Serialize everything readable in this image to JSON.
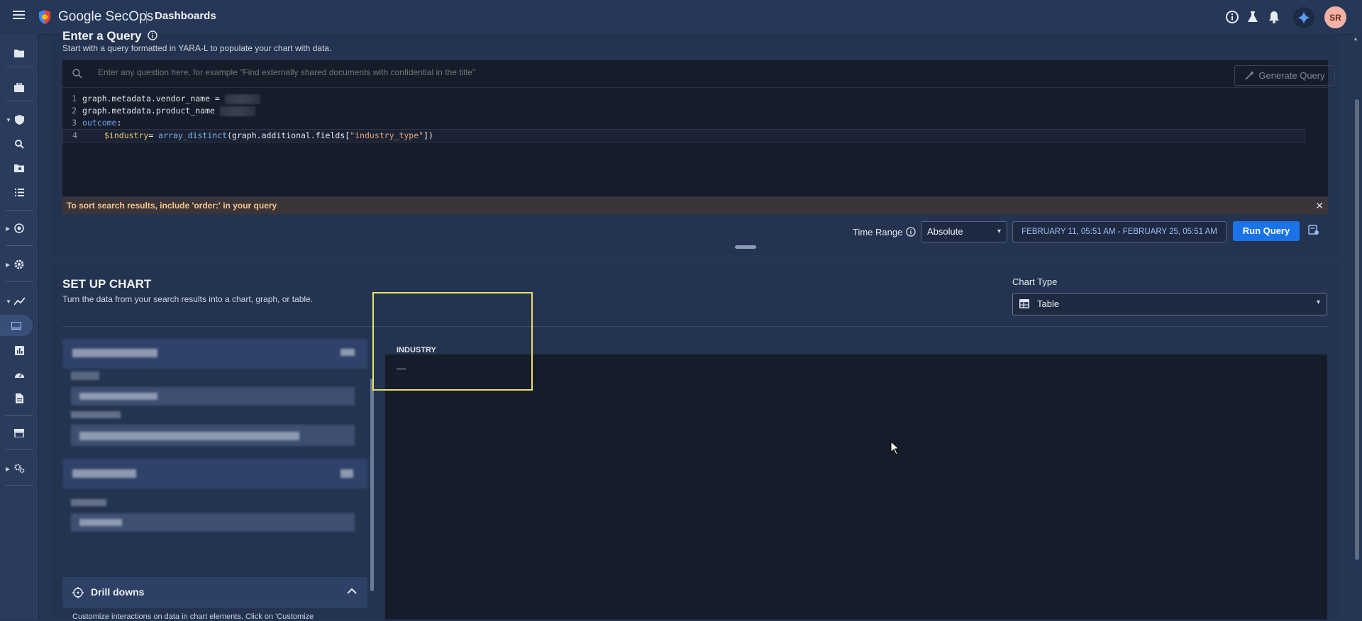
{
  "app": {
    "title": "Google SecOps",
    "page": "Dashboards"
  },
  "topbar": {
    "avatar_initials": "SR",
    "icons": [
      "info-icon",
      "lab-flask-icon",
      "bell-icon",
      "gemini-sparkle-icon"
    ]
  },
  "sidebar": {
    "icons": [
      "folder-icon",
      "case-icon",
      "shield-icon",
      "search-icon",
      "folder-search-icon",
      "list-icon",
      "radar-icon",
      "settings-gear-icon",
      "chart-line-icon",
      "dashboard-icon",
      "bar-chart-icon",
      "gauge-icon",
      "report-icon",
      "store-icon",
      "settings-cogs-icon"
    ]
  },
  "query": {
    "title": "Enter a Query",
    "subtitle": "Start with a query formatted in YARA-L to populate your chart with data.",
    "search_placeholder": "Enter any question here, for example \"Find externally shared documents with confidential in the title\"",
    "generate_label": "Generate Query",
    "code": {
      "line1": "graph.metadata.vendor_name = ",
      "line2": "graph.metadata.product_name ",
      "line3_kw": "outcome",
      "line3_rest": ":",
      "line4_var": "$industry",
      "line4_eq": "= ",
      "line4_fn": "array_distinct",
      "line4_open": "(graph.additional.fields[",
      "line4_str": "\"industry_type\"",
      "line4_close": "])"
    },
    "line_numbers": [
      "1",
      "2",
      "3",
      "4"
    ],
    "warning": "To sort search results, include 'order:' in your query",
    "time_range_label": "Time Range",
    "time_range_value": "Absolute",
    "date_range": "FEBRUARY 11, 05:51 AM - FEBRUARY 25, 05:51 AM",
    "run_label": "Run Query"
  },
  "chart": {
    "title": "SET UP CHART",
    "subtitle": "Turn the data from your search results into a chart, graph, or table.",
    "type_label": "Chart Type",
    "type_value": "Table",
    "drill_label": "Drill downs",
    "drill_desc": "Customize interactions on data in chart elements. Click on 'Customize",
    "table": {
      "column": "INDUSTRY",
      "cell": "—"
    }
  }
}
